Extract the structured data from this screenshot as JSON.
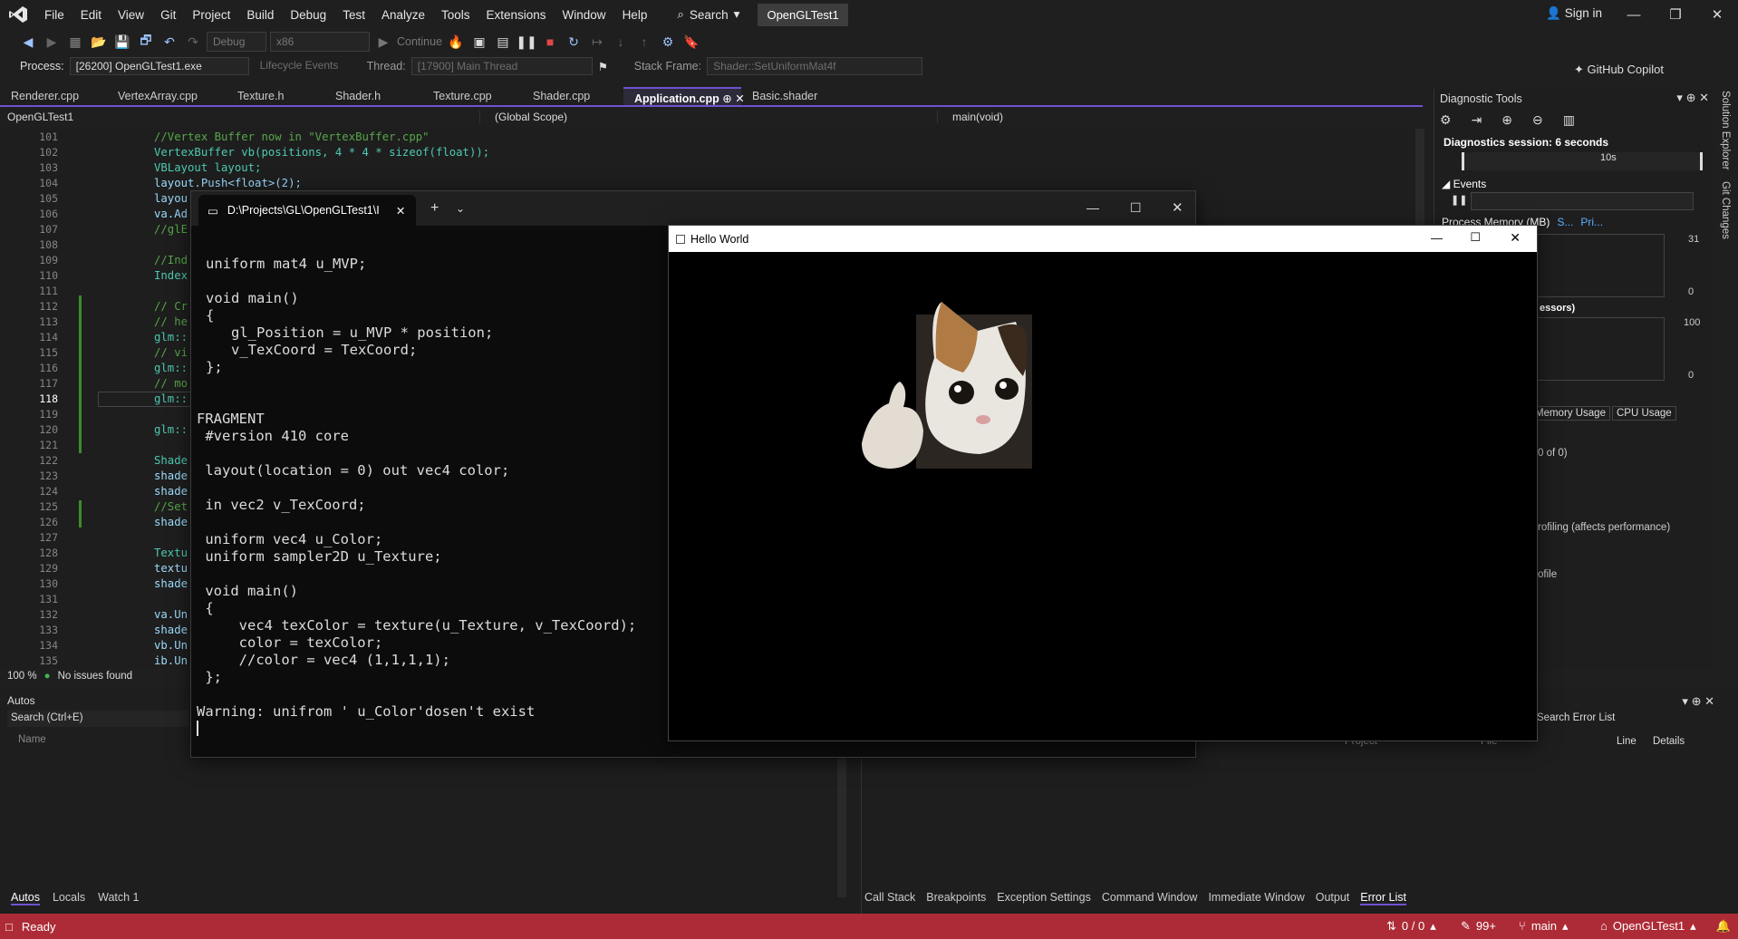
{
  "menu": {
    "items": [
      "File",
      "Edit",
      "View",
      "Git",
      "Project",
      "Build",
      "Debug",
      "Test",
      "Analyze",
      "Tools",
      "Extensions",
      "Window",
      "Help"
    ],
    "search": "Search",
    "solution_badge": "OpenGLTest1",
    "sign_in": "Sign in"
  },
  "toolbar": {
    "config": "Debug",
    "platform": "x86",
    "continue": "Continue",
    "copilot": "GitHub Copilot"
  },
  "debugbar": {
    "process_label": "Process:",
    "process_value": "[26200] OpenGLTest1.exe",
    "lifecycle": "Lifecycle Events",
    "thread_label": "Thread:",
    "thread_value": "[17900] Main Thread",
    "stackframe_label": "Stack Frame:",
    "stackframe_value": "Shader::SetUniformMat4f"
  },
  "tabs": [
    "Renderer.cpp",
    "VertexArray.cpp",
    "Texture.h",
    "Shader.h",
    "Texture.cpp",
    "Shader.cpp",
    "Application.cpp",
    "Basic.shader"
  ],
  "navbar": {
    "project": "OpenGLTest1",
    "scope": "(Global Scope)",
    "func": "main(void)"
  },
  "editor": {
    "lines": [
      "101",
      "102",
      "103",
      "104",
      "105",
      "106",
      "107",
      "108",
      "109",
      "110",
      "111",
      "112",
      "113",
      "114",
      "115",
      "116",
      "117",
      "118",
      "119",
      "120",
      "121",
      "122",
      "123",
      "124",
      "125",
      "126",
      "127",
      "128",
      "129",
      "130",
      "131",
      "132",
      "133",
      "134",
      "135"
    ],
    "current_line": "118",
    "visible_code": {
      "l101": "//Vertex Buffer now in \"VertexBuffer.cpp\"",
      "l102": "VertexBuffer vb(positions, 4 * 4 * sizeof(float));",
      "l103": "VBLayout layout;",
      "l104": "layout.Push<float>(2);",
      "l105": "layou",
      "l106": "va.Ad",
      "l107": "//glE",
      "l109": "//Ind",
      "l110": "Index",
      "l112": "// Cr",
      "l113": "// he",
      "l114": "glm::",
      "l115": "// vi",
      "l116": "glm::",
      "l117": "// mo",
      "l118": "glm::",
      "l120": "glm::",
      "l122": "Shade",
      "l123": "shade",
      "l124": "shade",
      "l125": "//Set",
      "l126": "shade",
      "l128": "Textu",
      "l129": "textu",
      "l130": "shade",
      "l132": "va.Un",
      "l133": "shade",
      "l134": "vb.Un",
      "l135": "ib.Un"
    },
    "zoom": "100 %",
    "issues": "No issues found"
  },
  "terminal": {
    "tab_title": "D:\\Projects\\GL\\OpenGLTest1\\I",
    "lines": [
      "uniform mat4 u_MVP;",
      "",
      "void main()",
      "{",
      "   gl_Position = u_MVP * position;",
      "   v_TexCoord = TexCoord;",
      "};",
      "",
      "",
      "FRAGMENT",
      " #version 410 core",
      "",
      " layout(location = 0) out vec4 color;",
      "",
      " in vec2 v_TexCoord;",
      "",
      " uniform vec4 u_Color;",
      " uniform sampler2D u_Texture;",
      "",
      " void main()",
      " {",
      "     vec4 texColor = texture(u_Texture, v_TexCoord);",
      "     color = texColor;",
      "     //color = vec4 (1,1,1,1);",
      " };",
      "",
      "Warning: unifrom ' u_Color'dosen't exist"
    ]
  },
  "hello_window": {
    "title": "Hello World"
  },
  "diagnostics": {
    "title": "Diagnostic Tools",
    "session": "Diagnostics session: 6 seconds",
    "timeline_tick": "10s",
    "events": "Events",
    "process_memory": "Process Memory (MB)",
    "legend_s": "S...",
    "legend_p": "Pri...",
    "mem_max": "31",
    "mem_min": "0",
    "cpu_label": "essors)",
    "cpu_max": "100",
    "cpu_min": "0",
    "tab_memory": "Memory Usage",
    "tab_cpu": "CPU Usage",
    "of_text": "0 of 0)",
    "profiling": "rofiling (affects performance)",
    "profile": "ofile"
  },
  "autos": {
    "title": "Autos",
    "search": "Search (Ctrl+E)",
    "col_name": "Name",
    "tabs": [
      "Autos",
      "Locals",
      "Watch 1"
    ]
  },
  "errorlist": {
    "search": "Search Error List",
    "cols": [
      "Project",
      "File",
      "Line",
      "Details"
    ],
    "tabs": [
      "Call Stack",
      "Breakpoints",
      "Exception Settings",
      "Command Window",
      "Immediate Window",
      "Output",
      "Error List"
    ]
  },
  "vertical_tabs": [
    "Solution Explorer",
    "Git Changes"
  ],
  "status": {
    "ready": "Ready",
    "updown": "0 / 0",
    "pencil": "99+",
    "branch": "main",
    "project": "OpenGLTest1"
  }
}
